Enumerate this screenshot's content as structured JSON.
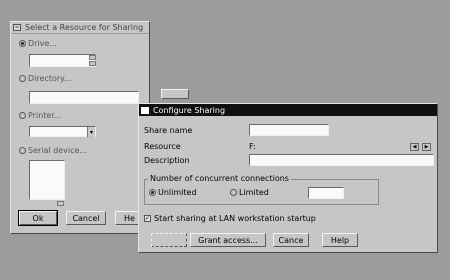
{
  "bg_window": {
    "title": "Select a Resource for Sharing",
    "drive_label": "Drive...",
    "directory_label": "Directory...",
    "printer_label": "Printer...",
    "serial_label": "Serial device...",
    "ok_label": "Ok",
    "cancel_label": "Cancel",
    "help_label": "He"
  },
  "dialog": {
    "title": "Configure Sharing",
    "share_name_label": "Share name",
    "share_name_value": "",
    "resource_label": "Resource",
    "resource_value": "F:",
    "description_label": "Description",
    "description_value": "",
    "group_label": "Number of concurrent connections",
    "unlimited_label": "Unlimited",
    "limited_label": "Limited",
    "limited_value": "",
    "startup_label": "Start sharing at LAN workstation startup",
    "grant_label": "Grant access...",
    "cancel_label": "Cance",
    "help_label": "Help"
  },
  "colors": {
    "desktop": "#9c9c9c",
    "window_face": "#c6c6c6",
    "active_titlebar": "#101010"
  }
}
